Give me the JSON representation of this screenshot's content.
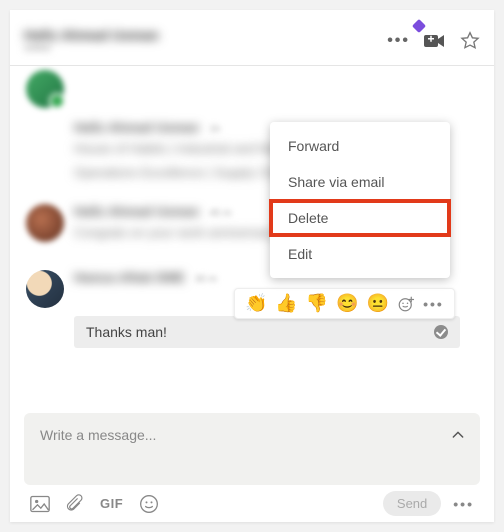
{
  "header": {
    "title": "Hafiz Ahmad Usman",
    "subtitle": "online"
  },
  "thread": {
    "posts": [
      {
        "name": "Hafiz Ahmad Usman",
        "time": "1h",
        "body_line1": "House of Habits | Industrial and Manufacturing",
        "body_line2": "Operations Excellence | Supply Chain management"
      },
      {
        "name": "Hafiz Ahmad Usman",
        "time": "45 m",
        "body": "Congrats on your work anniversary!"
      },
      {
        "name": "Hamza Aftab DME",
        "time": "30 m",
        "body": "Thanks man!"
      }
    ]
  },
  "context_menu": {
    "items": [
      "Forward",
      "Share via email",
      "Delete",
      "Edit"
    ],
    "highlight_index": 2
  },
  "reactions": {
    "icons": [
      "👏",
      "👍",
      "👎",
      "😊",
      "😐",
      "➕"
    ],
    "more": "•••"
  },
  "composer": {
    "placeholder": "Write a message...",
    "send_label": "Send",
    "gif_label": "GIF"
  }
}
